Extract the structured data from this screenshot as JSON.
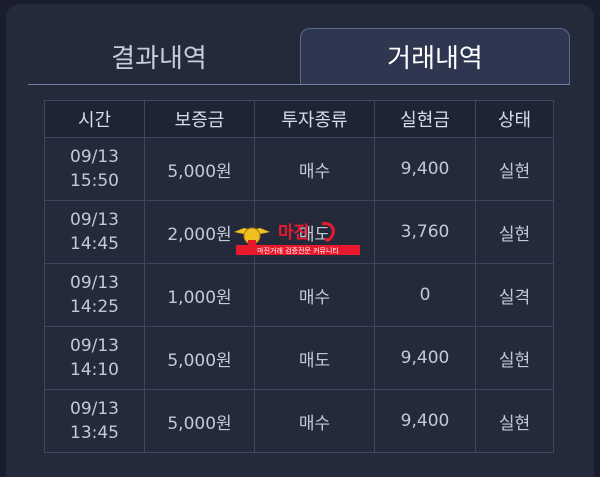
{
  "tabs": {
    "results_label": "결과내역",
    "history_label": "거래내역"
  },
  "table": {
    "headers": [
      "시간",
      "보증금",
      "투자종류",
      "실현금",
      "상태"
    ],
    "rows": [
      {
        "date": "09/13",
        "time": "15:50",
        "deposit": "5,000원",
        "type": "매수",
        "realized": "9,400",
        "status": "실현"
      },
      {
        "date": "09/13",
        "time": "14:45",
        "deposit": "2,000원",
        "type": "매도",
        "realized": "3,760",
        "status": "실현"
      },
      {
        "date": "09/13",
        "time": "14:25",
        "deposit": "1,000원",
        "type": "매수",
        "realized": "0",
        "status": "실격"
      },
      {
        "date": "09/13",
        "time": "14:10",
        "deposit": "5,000원",
        "type": "매도",
        "realized": "9,400",
        "status": "실현"
      },
      {
        "date": "09/13",
        "time": "13:45",
        "deposit": "5,000원",
        "type": "매수",
        "realized": "9,400",
        "status": "실현"
      }
    ]
  },
  "watermark": {
    "title": "마진",
    "subtitle": "마진거래 검증전문 커뮤니티"
  },
  "colors": {
    "win": "#39b36a",
    "lose": "#d85a5a",
    "accent": "#e8192c"
  }
}
